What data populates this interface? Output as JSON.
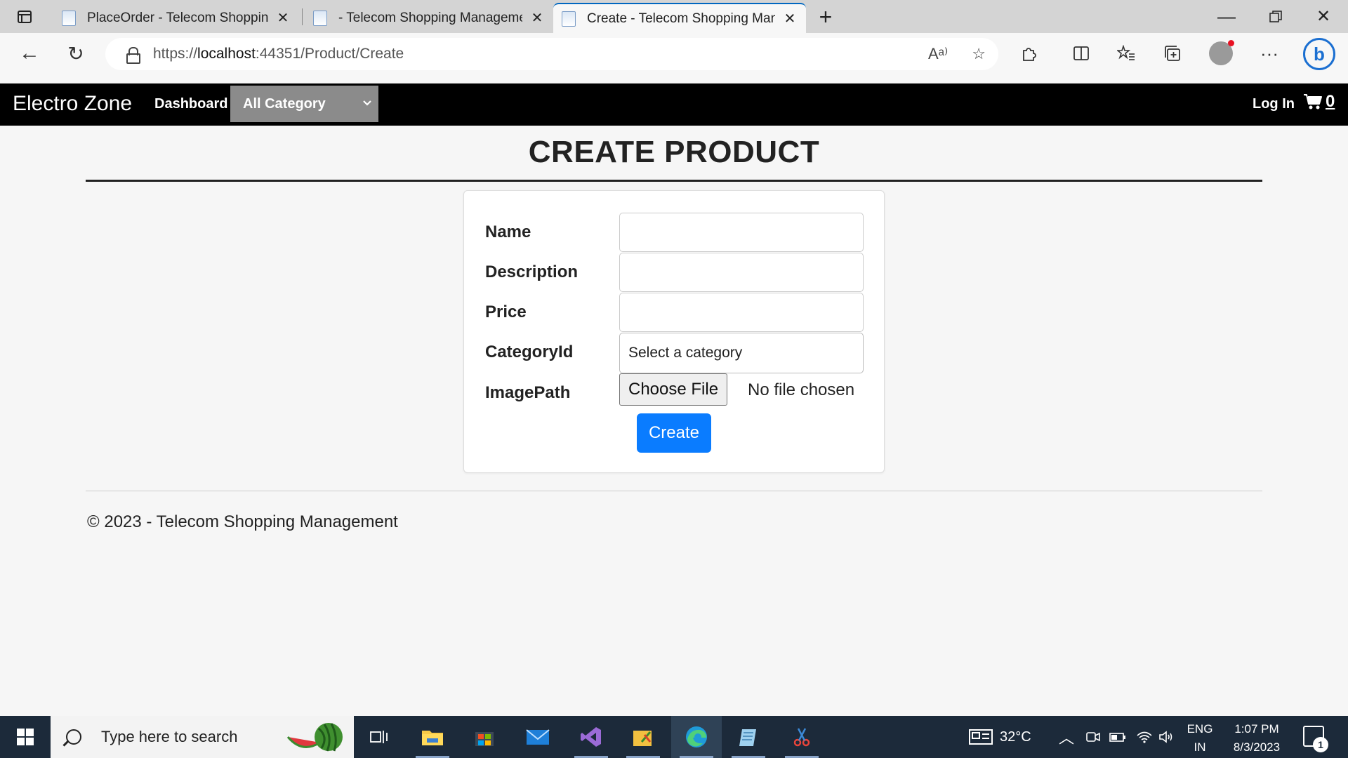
{
  "browser": {
    "tabs": [
      {
        "title": "PlaceOrder - Telecom Shopping Management"
      },
      {
        "title": "- Telecom Shopping Management"
      },
      {
        "title": "Create - Telecom Shopping Management"
      }
    ],
    "address": {
      "scheme": "https://",
      "host": "localhost",
      "rest": ":44351/Product/Create"
    },
    "read_aloud_label": "Aᵃ⁾"
  },
  "site": {
    "brand": "Electro Zone",
    "nav_dashboard": "Dashboard",
    "category_select": "All Category",
    "login": "Log In",
    "cart_count": "0"
  },
  "page": {
    "title": "CREATE PRODUCT",
    "form": {
      "name_label": "Name",
      "description_label": "Description",
      "price_label": "Price",
      "categoryid_label": "CategoryId",
      "categoryid_value": "Select a category",
      "imagepath_label": "ImagePath",
      "file_button": "Choose File",
      "file_status": "No file chosen",
      "submit": "Create"
    },
    "footer": "© 2023 - Telecom Shopping Management"
  },
  "taskbar": {
    "search_placeholder": "Type here to search",
    "weather": "32°C",
    "lang_top": "ENG",
    "lang_bottom": "IN",
    "time": "1:07 PM",
    "date": "8/3/2023",
    "notification_count": "1"
  }
}
